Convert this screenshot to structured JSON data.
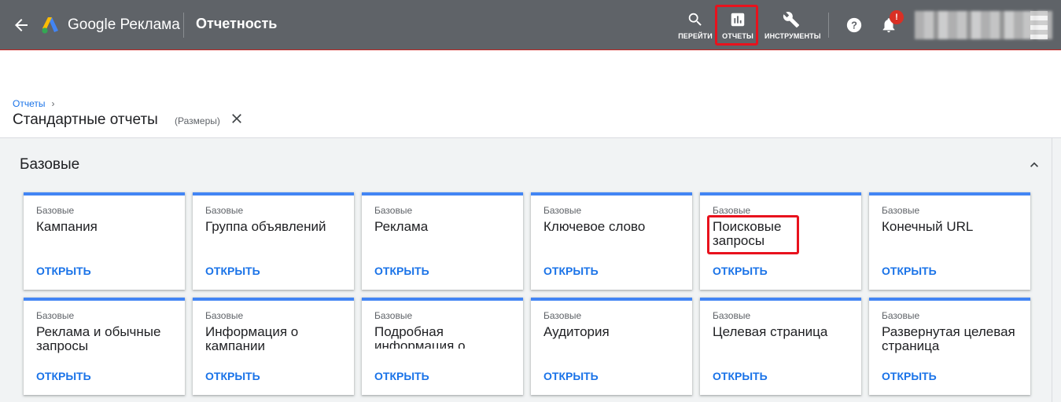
{
  "header": {
    "brand": "Google Реклама",
    "section_title": "Отчетность",
    "tools": {
      "search_label": "ПЕРЕЙТИ",
      "reports_label": "ОТЧЕТЫ",
      "tools_label": "ИНСТРУМЕНТЫ"
    },
    "notification_badge": "!"
  },
  "breadcrumb": {
    "parent": "Отчеты",
    "chevron": "›"
  },
  "page": {
    "title": "Стандартные отчеты",
    "subtitle": "(Размеры)"
  },
  "section": {
    "title": "Базовые",
    "cards": [
      {
        "kicker": "Базовые",
        "name": "Кампания",
        "action": "ОТКРЫТЬ"
      },
      {
        "kicker": "Базовые",
        "name": "Группа объявлений",
        "action": "ОТКРЫТЬ"
      },
      {
        "kicker": "Базовые",
        "name": "Реклама",
        "action": "ОТКРЫТЬ"
      },
      {
        "kicker": "Базовые",
        "name": "Ключевое слово",
        "action": "ОТКРЫТЬ"
      },
      {
        "kicker": "Базовые",
        "name": "Поисковые запросы",
        "action": "ОТКРЫТЬ"
      },
      {
        "kicker": "Базовые",
        "name": "Конечный URL",
        "action": "ОТКРЫТЬ"
      },
      {
        "kicker": "Базовые",
        "name": "Реклама и обычные запросы",
        "action": "ОТКРЫТЬ"
      },
      {
        "kicker": "Базовые",
        "name": "Информация о кампании",
        "action": "ОТКРЫТЬ"
      },
      {
        "kicker": "Базовые",
        "name": "Подробная информация о группах",
        "action": "ОТКРЫТЬ"
      },
      {
        "kicker": "Базовые",
        "name": "Аудитория",
        "action": "ОТКРЫТЬ"
      },
      {
        "kicker": "Базовые",
        "name": "Целевая страница",
        "action": "ОТКРЫТЬ"
      },
      {
        "kicker": "Базовые",
        "name": "Развернутая целевая страница",
        "action": "ОТКРЫТЬ"
      }
    ]
  },
  "colors": {
    "topbar": "#5f6368",
    "accent": "#4285f4",
    "link": "#1a73e8",
    "highlight": "#e8121d",
    "section_bg": "#f1f3f4"
  },
  "icons": {
    "back": "arrow-left-icon",
    "search": "search-icon",
    "reports": "bar-chart-icon",
    "tools": "wrench-icon",
    "help": "help-icon",
    "notifications": "bell-icon",
    "close": "close-icon",
    "collapse": "chevron-up-icon"
  }
}
